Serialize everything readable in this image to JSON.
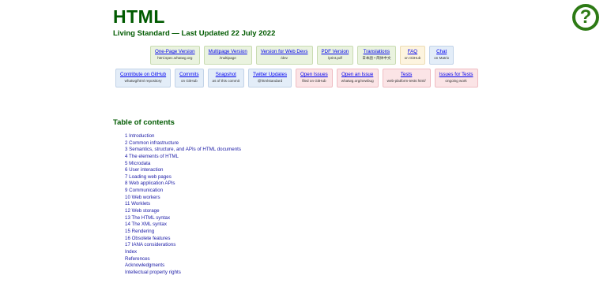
{
  "header": {
    "title": "HTML",
    "subtitle": "Living Standard — Last Updated 22 July 2022",
    "help_glyph": "?"
  },
  "links_row1": [
    {
      "label": "One-Page Version",
      "sub": "html.spec.whatwg.org",
      "color": "green"
    },
    {
      "label": "Multipage Version",
      "sub": "/multipage",
      "color": "green"
    },
    {
      "label": "Version for Web Devs",
      "sub": "/dev",
      "color": "green"
    },
    {
      "label": "PDF Version",
      "sub": "/print.pdf",
      "color": "green"
    },
    {
      "label": "Translations",
      "sub": "日本語 • 简体中文",
      "color": "green"
    },
    {
      "label": "FAQ",
      "sub": "on GitHub",
      "color": "yellow"
    },
    {
      "label": "Chat",
      "sub": "on Matrix",
      "color": "blue"
    }
  ],
  "links_row2": [
    {
      "label": "Contribute on GitHub",
      "sub": "whatwg/html repository",
      "color": "blue"
    },
    {
      "label": "Commits",
      "sub": "on GitHub",
      "color": "blue"
    },
    {
      "label": "Snapshot",
      "sub": "as of this commit",
      "color": "blue"
    },
    {
      "label": "Twitter Updates",
      "sub": "@htmlstandard",
      "color": "blue"
    },
    {
      "label": "Open Issues",
      "sub": "filed on GitHub",
      "color": "red"
    },
    {
      "label": "Open an Issue",
      "sub": "whatwg.org/newbug",
      "color": "red"
    },
    {
      "label": "Tests",
      "sub": "web-platform-tests html/",
      "color": "red"
    },
    {
      "label": "Issues for Tests",
      "sub": "ongoing work",
      "color": "red"
    }
  ],
  "toc": {
    "heading": "Table of contents",
    "items": [
      "1 Introduction",
      "2 Common infrastructure",
      "3 Semantics, structure, and APIs of HTML documents",
      "4 The elements of HTML",
      "5 Microdata",
      "6 User interaction",
      "7 Loading web pages",
      "8 Web application APIs",
      "9 Communication",
      "10 Web workers",
      "11 Worklets",
      "12 Web storage",
      "13 The HTML syntax",
      "14 The XML syntax",
      "15 Rendering",
      "16 Obsolete features",
      "17 IANA considerations",
      "Index",
      "References",
      "Acknowledgments",
      "Intellectual property rights"
    ]
  }
}
